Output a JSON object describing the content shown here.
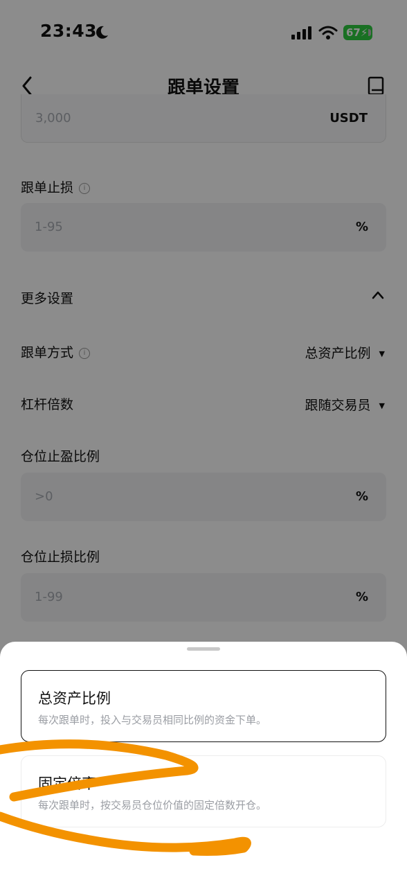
{
  "status_bar": {
    "time": "23:43",
    "battery": "67"
  },
  "header": {
    "title": "跟单设置"
  },
  "form": {
    "top_field": {
      "placeholder": "3,000",
      "unit": "USDT"
    },
    "stop_loss": {
      "label": "跟单止损",
      "placeholder": "1-95",
      "unit": "%"
    },
    "more_settings": {
      "label": "更多设置"
    },
    "follow_mode": {
      "label": "跟单方式",
      "value": "总资产比例"
    },
    "leverage": {
      "label": "杠杆倍数",
      "value": "跟随交易员"
    },
    "tp_ratio": {
      "label": "仓位止盈比例",
      "placeholder": ">0",
      "unit": "%"
    },
    "sl_ratio": {
      "label": "仓位止损比例",
      "placeholder": "1-99",
      "unit": "%"
    }
  },
  "sheet": {
    "options": [
      {
        "title": "总资产比例",
        "desc": "每次跟单时，投入与交易员相同比例的资金下单。",
        "selected": true
      },
      {
        "title": "固定倍率",
        "desc": "每次跟单时，按交易员仓位价值的固定倍数开仓。",
        "selected": false
      }
    ]
  },
  "colors": {
    "annotation_stroke": "#f39200",
    "battery": "#2ecc40"
  }
}
